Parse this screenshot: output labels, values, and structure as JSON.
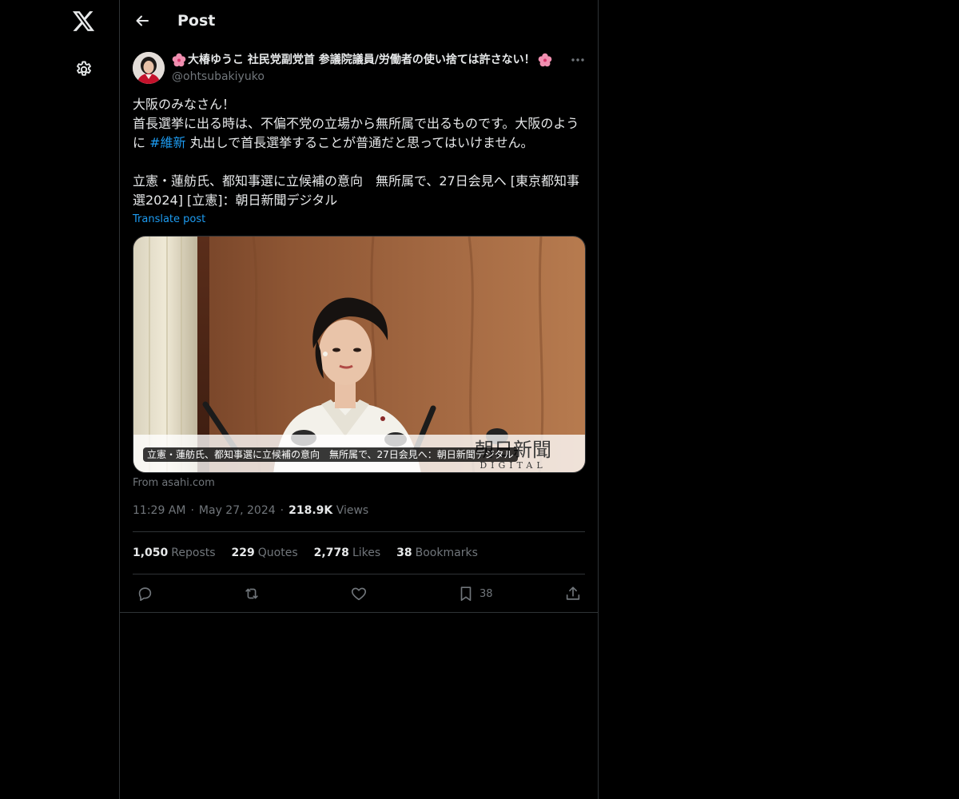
{
  "nav": {
    "logo_icon": "x-logo-icon",
    "settings_icon": "gear-icon"
  },
  "header": {
    "title": "Post",
    "back_icon": "arrow-left-icon"
  },
  "post": {
    "author_name": "大椿ゆうこ 社民党副党首 参議院議員/労働者の使い捨ては許さない！",
    "author_handle": "@ohtsubakiyuko",
    "text_line1": "大阪のみなさん！",
    "text_line2a": "首長選挙に出る時は、不偏不党の立場から無所属で出るものです。大阪のように ",
    "hashtag": "#維新",
    "text_line2b": " 丸出しで首長選挙することが普通だと思ってはいけません。",
    "text_line3": "立憲・蓮舫氏、都知事選に立候補の意向　無所属で、27日会見へ [東京都知事選2024] [立憲]：朝日新聞デジタル",
    "translate_label": "Translate post"
  },
  "card": {
    "caption": "立憲・蓮舫氏、都知事選に立候補の意向　無所属で、27日会見へ：朝日新聞デジタル",
    "source": "From asahi.com",
    "logo_text": "朝日新聞",
    "logo_sub": "DIGITAL"
  },
  "meta": {
    "time": "11:29 AM",
    "date": "May 27, 2024",
    "views_count": "218.9K",
    "views_label": "Views",
    "separator": "·"
  },
  "stats": {
    "reposts_count": "1,050",
    "reposts_label": "Reposts",
    "quotes_count": "229",
    "quotes_label": "Quotes",
    "likes_count": "2,778",
    "likes_label": "Likes",
    "bookmarks_count": "38",
    "bookmarks_label": "Bookmarks"
  },
  "actions": {
    "reply_icon": "reply-icon",
    "repost_icon": "repost-icon",
    "like_icon": "heart-icon",
    "bookmark_icon": "bookmark-icon",
    "bookmark_count": "38",
    "share_icon": "share-icon"
  },
  "colors": {
    "background": "#000000",
    "text_primary": "#e7e9ea",
    "text_secondary": "#71767b",
    "accent": "#1d9bf0",
    "border": "#2f3336"
  }
}
